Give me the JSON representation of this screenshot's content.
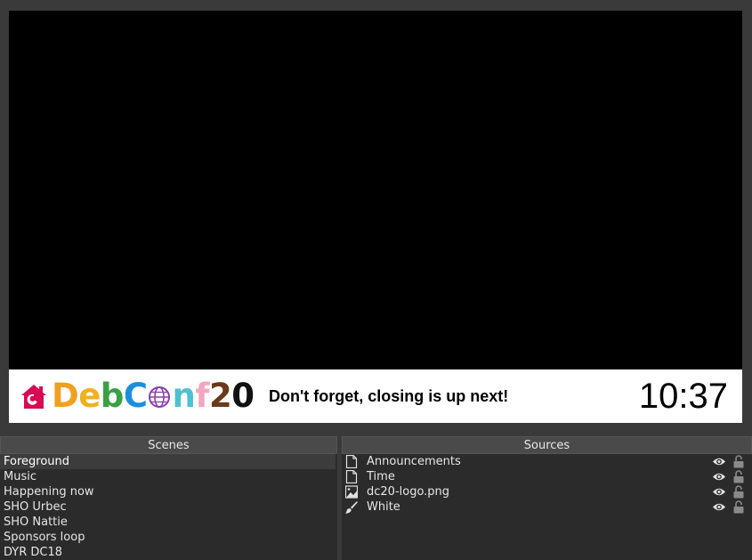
{
  "preview": {
    "lower_third": {
      "logo_letters": [
        {
          "text": "D",
          "color": "#f0a020"
        },
        {
          "text": "e",
          "color": "#f0b020"
        },
        {
          "text": "b",
          "color": "#3aa043"
        },
        {
          "text": "C",
          "color": "#1a8fe0"
        },
        {
          "text": "n",
          "color": "#50c0d0"
        },
        {
          "text": "f",
          "color": "#f4a6c0"
        },
        {
          "text": "2",
          "color": "#6b3a1a"
        },
        {
          "text": "0",
          "color": "#111111"
        }
      ],
      "logo_text": "DebConf20",
      "announcement": "Don't forget, closing is up next!",
      "clock": "10:37"
    }
  },
  "scenes": {
    "title": "Scenes",
    "items": [
      {
        "label": "Foreground",
        "selected": true
      },
      {
        "label": "Music"
      },
      {
        "label": "Happening now"
      },
      {
        "label": "SHO Urbec"
      },
      {
        "label": "SHO Nattie"
      },
      {
        "label": "Sponsors loop"
      },
      {
        "label": "DYR DC18"
      }
    ]
  },
  "sources": {
    "title": "Sources",
    "items": [
      {
        "label": "Announcements",
        "icon": "text-file-icon",
        "visible": true,
        "locked": false
      },
      {
        "label": "Time",
        "icon": "text-file-icon",
        "visible": true,
        "locked": false
      },
      {
        "label": "dc20-logo.png",
        "icon": "image-icon",
        "visible": true,
        "locked": false
      },
      {
        "label": "White",
        "icon": "brush-icon",
        "visible": true,
        "locked": false
      }
    ]
  },
  "colors": {
    "debian_red": "#d70a53",
    "panel_bg": "#2b2b2b",
    "window_bg": "#3a3a3a"
  }
}
